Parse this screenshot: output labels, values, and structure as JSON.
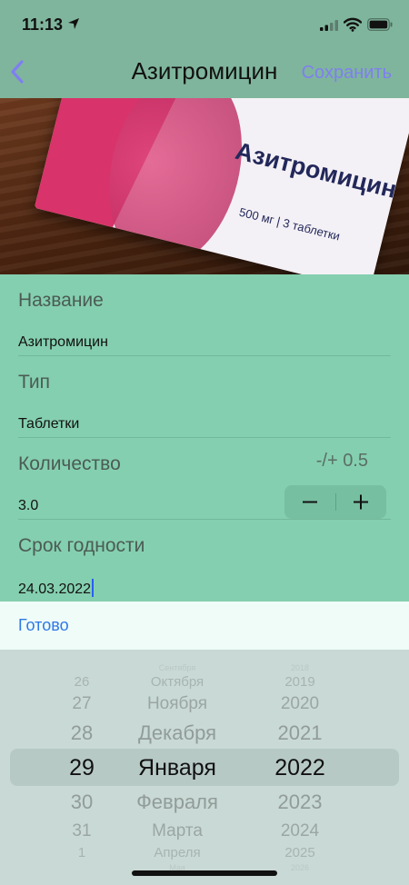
{
  "status_bar": {
    "time": "11:13"
  },
  "nav": {
    "title": "Азитромицин",
    "save_label": "Сохранить"
  },
  "photo": {
    "box_name": "Азитромицин",
    "box_subtitle": "500 мг | 3 таблетки"
  },
  "form": {
    "name_label": "Название",
    "name_value": "Азитромицин",
    "type_label": "Тип",
    "type_value": "Таблетки",
    "quantity_label": "Количество",
    "quantity_step_hint": "-/+ 0.5",
    "quantity_value": "3.0",
    "expiry_label": "Срок годности",
    "expiry_value": "24.03.2022"
  },
  "toolbar": {
    "done_label": "Готово"
  },
  "picker": {
    "days": [
      "",
      "26",
      "27",
      "28",
      "29",
      "30",
      "31",
      "1",
      ""
    ],
    "months": [
      "Сентября",
      "Октября",
      "Ноября",
      "Декабря",
      "Января",
      "Февраля",
      "Марта",
      "Апреля",
      "Мая"
    ],
    "years": [
      "2018",
      "2019",
      "2020",
      "2021",
      "2022",
      "2023",
      "2024",
      "2025",
      "2026"
    ],
    "selected_index": 4
  },
  "colors": {
    "accent": "#7f7ff0",
    "form_bg": "#84cfaf",
    "header_bg": "#7fb59c",
    "done": "#2f78e6"
  }
}
